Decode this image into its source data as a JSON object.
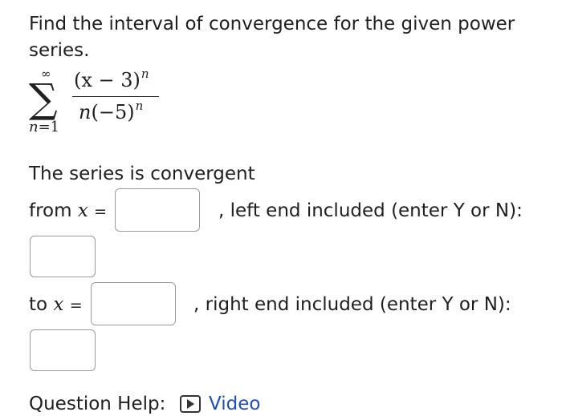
{
  "question": {
    "prompt": "Find the interval of convergence for the given power series."
  },
  "series": {
    "sum_upper": "∞",
    "sum_symbol": "∑",
    "sum_lower_var": "n",
    "sum_lower_eq": "=1",
    "numerator_base": "(x − 3)",
    "numerator_exp": "n",
    "denominator_coef": "n",
    "denominator_base": "(−5)",
    "denominator_exp": "n"
  },
  "answer": {
    "convergent_text": "The series is convergent",
    "from_label": "from",
    "to_label": "to",
    "var": "x",
    "equals": "=",
    "from_value": "",
    "left_end_value": "",
    "to_value": "",
    "right_end_value": "",
    "left_end_text": ", left end included (enter Y or N):",
    "right_end_text": ", right end included (enter Y or N):"
  },
  "help": {
    "label": "Question Help:",
    "video_label": "Video",
    "video_icon": "play-video-icon",
    "link_color": "#1f4fb5"
  }
}
